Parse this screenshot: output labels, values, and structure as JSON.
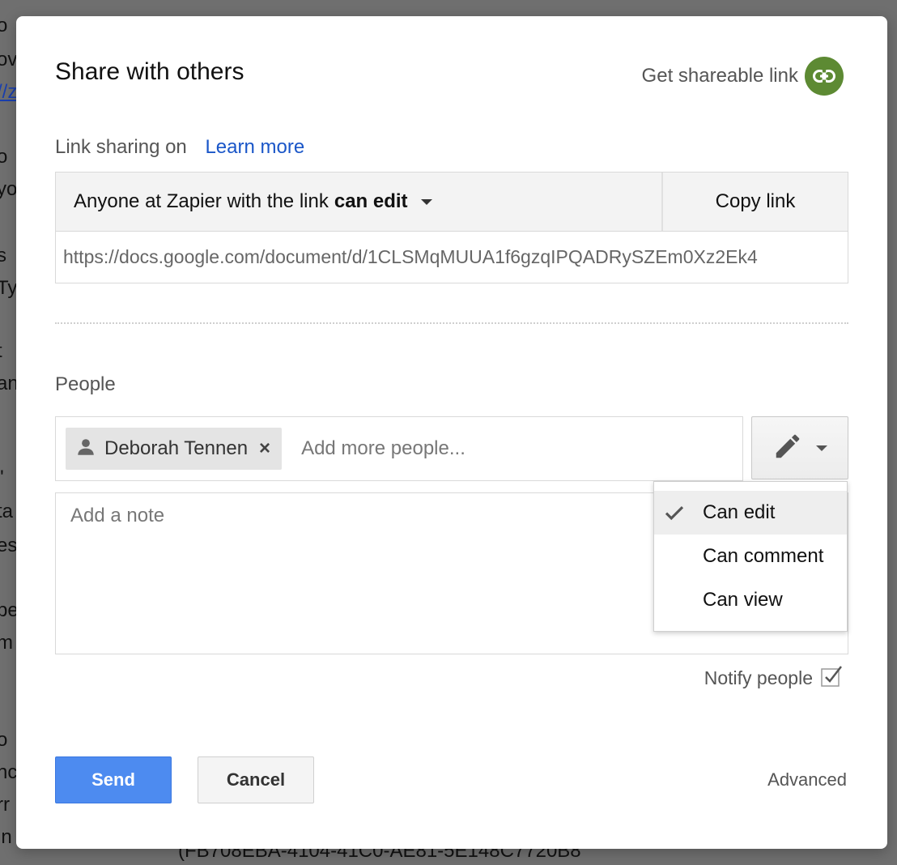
{
  "background_fragments": [
    "o",
    "ov",
    "//z",
    "o",
    "yo",
    "s",
    "Ty",
    "t",
    "an",
    "\"",
    "ta",
    "es",
    "pe",
    "m",
    "o",
    "nc",
    "rr",
    "in"
  ],
  "background_bottom_text": "(FB708EBA-4104-41C0-AE81-5E148C7720B8",
  "dialog": {
    "title": "Share with others",
    "get_link_label": "Get shareable link",
    "link_sharing_label": "Link sharing on",
    "learn_more": "Learn more",
    "access": {
      "prefix": "Anyone at Zapier with the link",
      "level": "can edit"
    },
    "copy_link": "Copy link",
    "url": "https://docs.google.com/document/d/1CLSMqMUUA1f6gzqIPQADRySZEm0Xz2Ek4",
    "people_label": "People",
    "chip_name": "Deborah Tennen",
    "chip_remove": "×",
    "add_people_placeholder": "Add more people...",
    "note_placeholder": "Add a note",
    "permission_menu": [
      "Can edit",
      "Can comment",
      "Can view"
    ],
    "notify_label": "Notify people",
    "send": "Send",
    "cancel": "Cancel",
    "advanced": "Advanced"
  },
  "colors": {
    "link_icon_bg": "#5d8a33",
    "send_bg": "#4d8bf0",
    "learn_more": "#1a56c8"
  },
  "icons": {
    "share_link": "link-icon",
    "person": "person-icon",
    "permission": "pencil-icon",
    "selected": "check-icon",
    "notify": "checkbox-checked-icon"
  }
}
